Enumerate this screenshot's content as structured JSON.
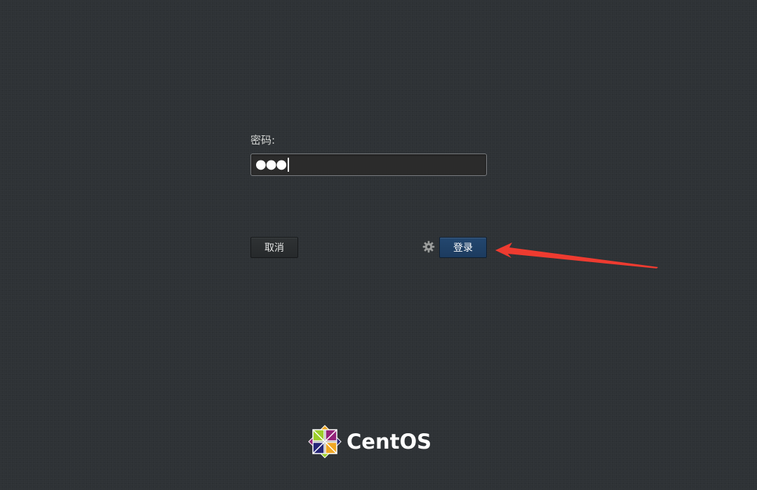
{
  "login": {
    "password_label": "密码:",
    "password_value": "●●●",
    "cancel_label": "取消",
    "login_label": "登录",
    "settings_icon": "gear-icon"
  },
  "annotation": {
    "arrow_color": "#ee3b30",
    "icon": "red-arrow-icon"
  },
  "brand": {
    "name": "CentOS",
    "logo_icon": "centos-logo-icon",
    "logo_colors": [
      "#9ccd2a",
      "#932279",
      "#efa724",
      "#262577"
    ]
  },
  "colors": {
    "background": "#2e3235",
    "primary_button": "#1f4169",
    "text": "#d4d6d4"
  }
}
